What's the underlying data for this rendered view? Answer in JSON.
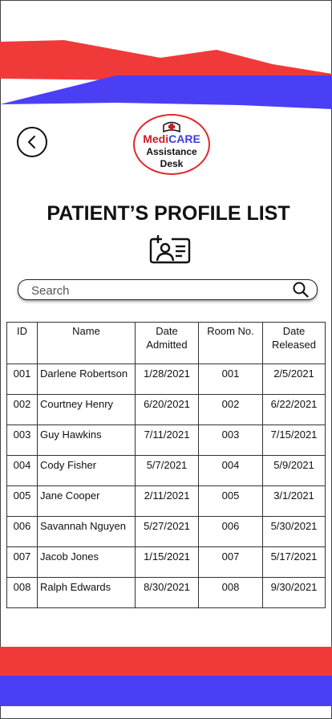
{
  "colors": {
    "accent_red": "#f03a3a",
    "accent_blue": "#4a3ff5"
  },
  "header": {
    "back_icon": "chevron-left-icon"
  },
  "logo": {
    "medi": "Medi",
    "care": "CARE",
    "line2": "Assistance",
    "line3": "Desk",
    "icon": "nurse-cap-icon"
  },
  "page": {
    "title": "PATIENT’S PROFILE LIST",
    "title_icon": "add-patient-card-icon"
  },
  "search": {
    "placeholder": "Search",
    "icon": "search-icon"
  },
  "table": {
    "headers": {
      "id": "ID",
      "name": "Name",
      "admitted_1": "Date",
      "admitted_2": "Admitted",
      "room": "Room No.",
      "released_1": "Date",
      "released_2": "Released"
    },
    "rows": [
      {
        "id": "001",
        "name": "Darlene Robertson",
        "admitted": "1/28/2021",
        "room": "001",
        "released": "2/5/2021"
      },
      {
        "id": "002",
        "name": "Courtney Henry",
        "admitted": "6/20/2021",
        "room": "002",
        "released": "6/22/2021"
      },
      {
        "id": "003",
        "name": "Guy Hawkins",
        "admitted": "7/11/2021",
        "room": "003",
        "released": "7/15/2021"
      },
      {
        "id": "004",
        "name": "Cody Fisher",
        "admitted": "5/7/2021",
        "room": "004",
        "released": "5/9/2021"
      },
      {
        "id": "005",
        "name": "Jane Cooper",
        "admitted": "2/11/2021",
        "room": "005",
        "released": "3/1/2021"
      },
      {
        "id": "006",
        "name": "Savannah Nguyen",
        "admitted": "5/27/2021",
        "room": "006",
        "released": "5/30/2021"
      },
      {
        "id": "007",
        "name": "Jacob Jones",
        "admitted": "1/15/2021",
        "room": "007",
        "released": "5/17/2021"
      },
      {
        "id": "008",
        "name": "Ralph Edwards",
        "admitted": "8/30/2021",
        "room": "008",
        "released": "9/30/2021"
      }
    ]
  }
}
